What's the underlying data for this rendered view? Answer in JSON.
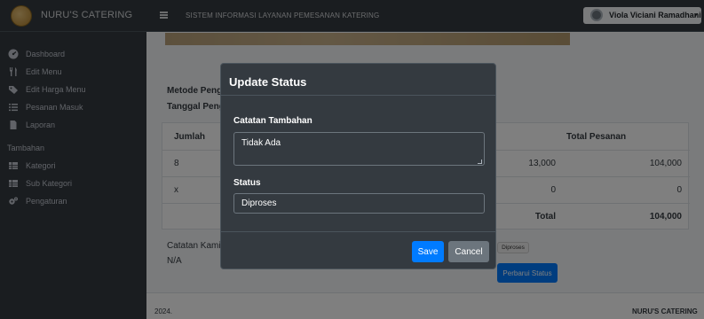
{
  "app": {
    "brand": "NURU'S CATERING",
    "title": "SISTEM INFORMASI LAYANAN PEMESANAN KATERING"
  },
  "user": {
    "name": "Viola Viciani Ramadhani",
    "caret": "▾"
  },
  "sidebar": {
    "items": [
      {
        "label": "Dashboard",
        "icon": "dashboard-icon"
      },
      {
        "label": "Edit Menu",
        "icon": "utensils-icon"
      },
      {
        "label": "Edit Harga Menu",
        "icon": "tag-icon"
      },
      {
        "label": "Pesanan Masuk",
        "icon": "list-icon"
      },
      {
        "label": "Laporan",
        "icon": "file-icon"
      }
    ],
    "section_header": "Tambahan",
    "extra_items": [
      {
        "label": "Kategori",
        "icon": "table-icon"
      },
      {
        "label": "Sub Kategori",
        "icon": "table-icon"
      },
      {
        "label": "Pengaturan",
        "icon": "gears-icon"
      }
    ]
  },
  "order": {
    "metode_label": "Metode Peng",
    "tanggal_label": "Tanggal Peng",
    "table": {
      "headers": {
        "col1": "Jumlah",
        "col4": "Total Pesanan"
      },
      "rows": [
        {
          "jumlah": "8",
          "harga": "13,000",
          "total": "104,000"
        },
        {
          "jumlah": "x",
          "harga": "0",
          "total": "0"
        }
      ],
      "total_label": "Total",
      "grand_total": "104,000"
    },
    "catatan_label": "Catatan Kami",
    "catatan_value": "N/A",
    "status_badge": "Diproses",
    "update_button": "Perbarui Status"
  },
  "footer": {
    "year": "2024.",
    "brand": "NURU'S CATERING"
  },
  "modal": {
    "title": "Update Status",
    "catatan_label": "Catatan Tambahan",
    "catatan_value": "Tidak Ada",
    "status_label": "Status",
    "status_value": "Diproses",
    "save_label": "Save",
    "cancel_label": "Cancel"
  },
  "colors": {
    "sidebar_bg": "#343a40",
    "content_bg": "#f4f6f9",
    "primary": "#007bff",
    "secondary": "#6c757d"
  }
}
